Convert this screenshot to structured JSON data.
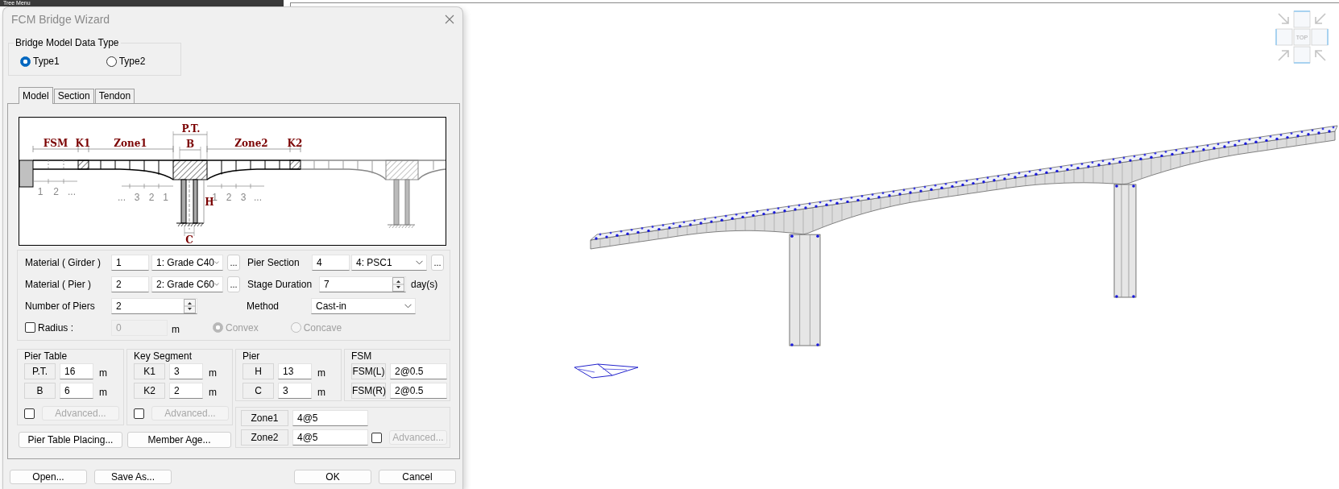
{
  "tree_menu": {
    "title": "Tree Menu"
  },
  "dialog": {
    "title": "FCM Bridge Wizard"
  },
  "data_type": {
    "title": "Bridge Model Data Type",
    "options": [
      {
        "label": "Type1",
        "selected": true
      },
      {
        "label": "Type2",
        "selected": false
      }
    ]
  },
  "tabs": [
    {
      "label": "Model",
      "selected": true
    },
    {
      "label": "Section",
      "selected": false
    },
    {
      "label": "Tendon",
      "selected": false
    }
  ],
  "diagram": {
    "labels": [
      "FSM",
      "K1",
      "Zone1",
      "P.T.",
      "B",
      "Zone2",
      "K2",
      "H",
      "C"
    ],
    "segment_numbers": [
      "1",
      "2",
      "...",
      "...",
      "3",
      "2",
      "1",
      "1",
      "2",
      "3",
      "..."
    ]
  },
  "material": {
    "girder": {
      "label": "Material ( Girder )",
      "number": "1",
      "selection": "1: Grade C40",
      "browse": "..."
    },
    "pier_section": {
      "label": "Pier Section",
      "number": "4",
      "selection": "4: PSC1",
      "browse": "..."
    },
    "pier": {
      "label": "Material ( Pier )",
      "number": "2",
      "selection": "2: Grade C60",
      "browse": "..."
    },
    "stage_duration": {
      "label": "Stage Duration",
      "value": "7",
      "unit": "day(s)"
    },
    "number_of_piers": {
      "label": "Number of Piers",
      "value": "2"
    },
    "method": {
      "label": "Method",
      "selection": "Cast-in"
    },
    "radius": {
      "checked": false,
      "label": "Radius :",
      "value": "0",
      "unit": "m",
      "options": [
        {
          "label": "Convex",
          "selected": true,
          "disabled": true
        },
        {
          "label": "Concave",
          "selected": false,
          "disabled": true
        }
      ]
    }
  },
  "pier_table": {
    "title": "Pier Table",
    "rows": [
      {
        "label": "P.T.",
        "value": "16",
        "unit": "m"
      },
      {
        "label": "B",
        "value": "6",
        "unit": "m"
      }
    ],
    "advanced": {
      "checked": false,
      "label": "Advanced...",
      "disabled": true
    }
  },
  "key_segment": {
    "title": "Key Segment",
    "rows": [
      {
        "label": "K1",
        "value": "3",
        "unit": "m"
      },
      {
        "label": "K2",
        "value": "2",
        "unit": "m"
      }
    ],
    "advanced": {
      "checked": false,
      "label": "Advanced...",
      "disabled": true
    }
  },
  "pier": {
    "title": "Pier",
    "rows": [
      {
        "label": "H",
        "value": "13",
        "unit": "m"
      },
      {
        "label": "C",
        "value": "3",
        "unit": "m"
      }
    ]
  },
  "fsm": {
    "title": "FSM",
    "rows": [
      {
        "label": "FSM(L)",
        "value": "2@0.5"
      },
      {
        "label": "FSM(R)",
        "value": "2@0.5"
      }
    ]
  },
  "zones": {
    "rows": [
      {
        "label": "Zone1",
        "value": "4@5"
      },
      {
        "label": "Zone2",
        "value": "4@5"
      }
    ],
    "advanced": {
      "checked": false,
      "label": "Advanced...",
      "disabled": true
    }
  },
  "action_buttons": [
    "Pier Table Placing...",
    "Member Age..."
  ],
  "footer_buttons": [
    "Open...",
    "Save As...",
    "OK",
    "Cancel"
  ],
  "view_cube": {
    "label": "TOP"
  }
}
